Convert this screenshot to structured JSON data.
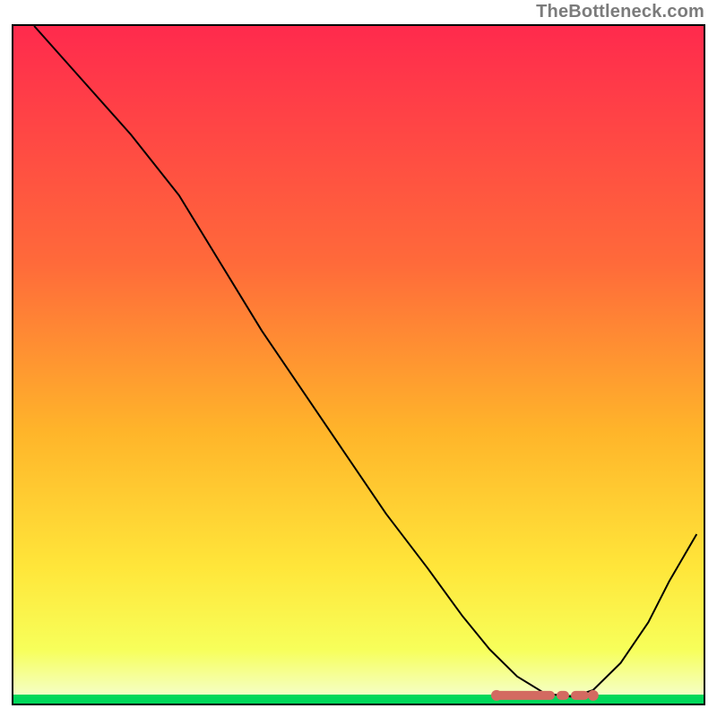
{
  "attribution": "TheBottleneck.com",
  "chart_data": {
    "type": "line",
    "title": "",
    "xlabel": "",
    "ylabel": "",
    "xlim": [
      0,
      100
    ],
    "ylim": [
      0,
      100
    ],
    "grid": false,
    "legend": false,
    "x": [
      3,
      10,
      17,
      24,
      30,
      36,
      42,
      48,
      54,
      60,
      65,
      69,
      73,
      77,
      81,
      84,
      88,
      92,
      95,
      99
    ],
    "values": [
      100,
      92,
      84,
      75,
      65,
      55,
      46,
      37,
      28,
      20,
      13,
      8,
      4,
      1.5,
      1,
      2,
      6,
      12,
      18,
      25
    ],
    "minimum_region_x": [
      70,
      84
    ],
    "marker_color": "#d36a61",
    "gradient_stops": [
      {
        "offset": 0,
        "color": "#ff2a4d"
      },
      {
        "offset": 35,
        "color": "#ff6a3a"
      },
      {
        "offset": 60,
        "color": "#ffb52a"
      },
      {
        "offset": 80,
        "color": "#ffe63a"
      },
      {
        "offset": 92,
        "color": "#f7ff5a"
      },
      {
        "offset": 100,
        "color": "#f4ffd9"
      }
    ],
    "baseline_band_color": "#00d85a"
  }
}
